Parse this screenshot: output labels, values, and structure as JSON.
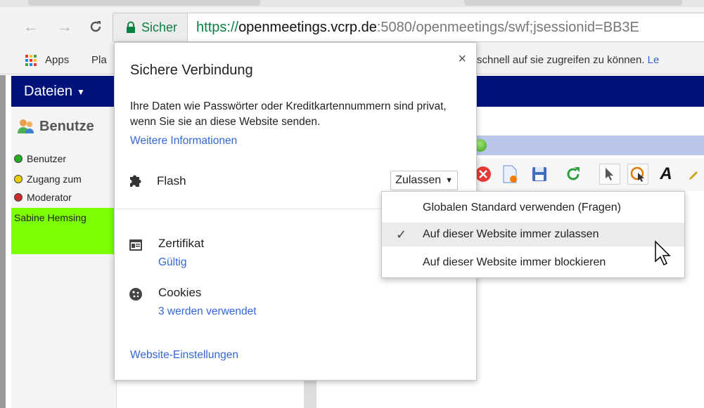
{
  "browser": {
    "secure_label": "Sicher",
    "url_scheme": "https://",
    "url_host": "openmeetings.vcrp.de",
    "url_rest": ":5080/openmeetings/swf;jsessionid=BB3E",
    "apps_label": "Apps",
    "bookmark_partial": "Pla",
    "bookmarks_hint": "schnell auf sie zugreifen zu können.",
    "bookmarks_hint_link": "Le"
  },
  "app": {
    "menu_files": "Dateien",
    "users_title": "Benutze",
    "legend": [
      {
        "label": "Benutzer",
        "color": "#22b022"
      },
      {
        "label": "Zugang zum",
        "color": "#e8d000"
      },
      {
        "label": "Moderator",
        "color": "#cc2a2a"
      }
    ],
    "user_name": "Sabine Hemsing"
  },
  "popup": {
    "title": "Sichere Verbindung",
    "description": "Ihre Daten wie Passwörter oder Kreditkartennummern sind privat, wenn Sie sie an diese Website senden.",
    "more_info_link": "Weitere Informationen",
    "permission_label": "Flash",
    "permission_value": "Zulassen",
    "certificate_label": "Zertifikat",
    "certificate_status": "Gültig",
    "cookies_label": "Cookies",
    "cookies_status": "3 werden verwendet",
    "site_settings_link": "Website-Einstellungen",
    "close_glyph": "×"
  },
  "dropdown": {
    "items": [
      {
        "label": "Globalen Standard verwenden (Fragen)",
        "selected": false
      },
      {
        "label": "Auf dieser Website immer zulassen",
        "selected": true
      },
      {
        "label": "Auf dieser Website immer blockieren",
        "selected": false
      }
    ],
    "check_glyph": "✓"
  },
  "colors": {
    "secure_green": "#0b8043",
    "link_blue": "#3367d6",
    "menubar_navy": "#00137d",
    "user_highlight": "#7cff00"
  }
}
